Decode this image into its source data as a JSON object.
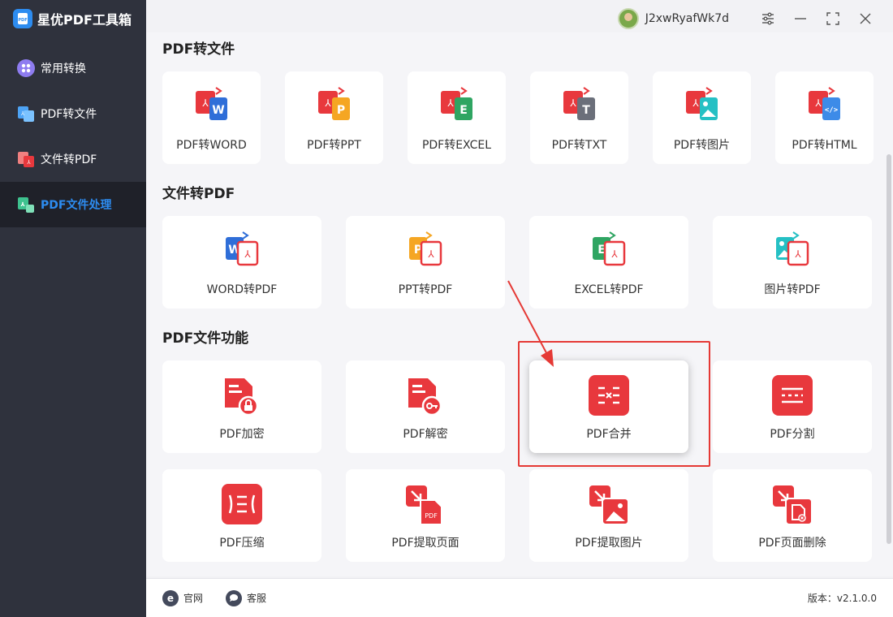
{
  "app": {
    "title": "星优PDF工具箱",
    "logo_icon": "pdf-logo-icon"
  },
  "user": {
    "name": "J2xwRyafWk7d"
  },
  "sidebar": {
    "items": [
      {
        "label": "常用转换",
        "icon": "apps-icon",
        "active": false
      },
      {
        "label": "PDF转文件",
        "icon": "pdf-to-file-icon",
        "active": false
      },
      {
        "label": "文件转PDF",
        "icon": "file-to-pdf-icon",
        "active": false
      },
      {
        "label": "PDF文件处理",
        "icon": "pdf-process-icon",
        "active": true
      }
    ]
  },
  "sections": {
    "pdf_to_file": {
      "title": "PDF转文件",
      "items": [
        "PDF转WORD",
        "PDF转PPT",
        "PDF转EXCEL",
        "PDF转TXT",
        "PDF转图片",
        "PDF转HTML"
      ]
    },
    "file_to_pdf": {
      "title": "文件转PDF",
      "items": [
        "WORD转PDF",
        "PPT转PDF",
        "EXCEL转PDF",
        "图片转PDF"
      ]
    },
    "pdf_functions": {
      "title": "PDF文件功能",
      "items": [
        "PDF加密",
        "PDF解密",
        "PDF合并",
        "PDF分割",
        "PDF压缩",
        "PDF提取页面",
        "PDF提取图片",
        "PDF页面删除"
      ]
    }
  },
  "footer": {
    "website": "官网",
    "service": "客服",
    "version": "版本：v2.1.0.0"
  },
  "colors": {
    "accent": "#2d8cf0",
    "brand_red": "#e8383d",
    "sidebar_bg": "#2f323d",
    "highlight_box": "#e53935"
  }
}
